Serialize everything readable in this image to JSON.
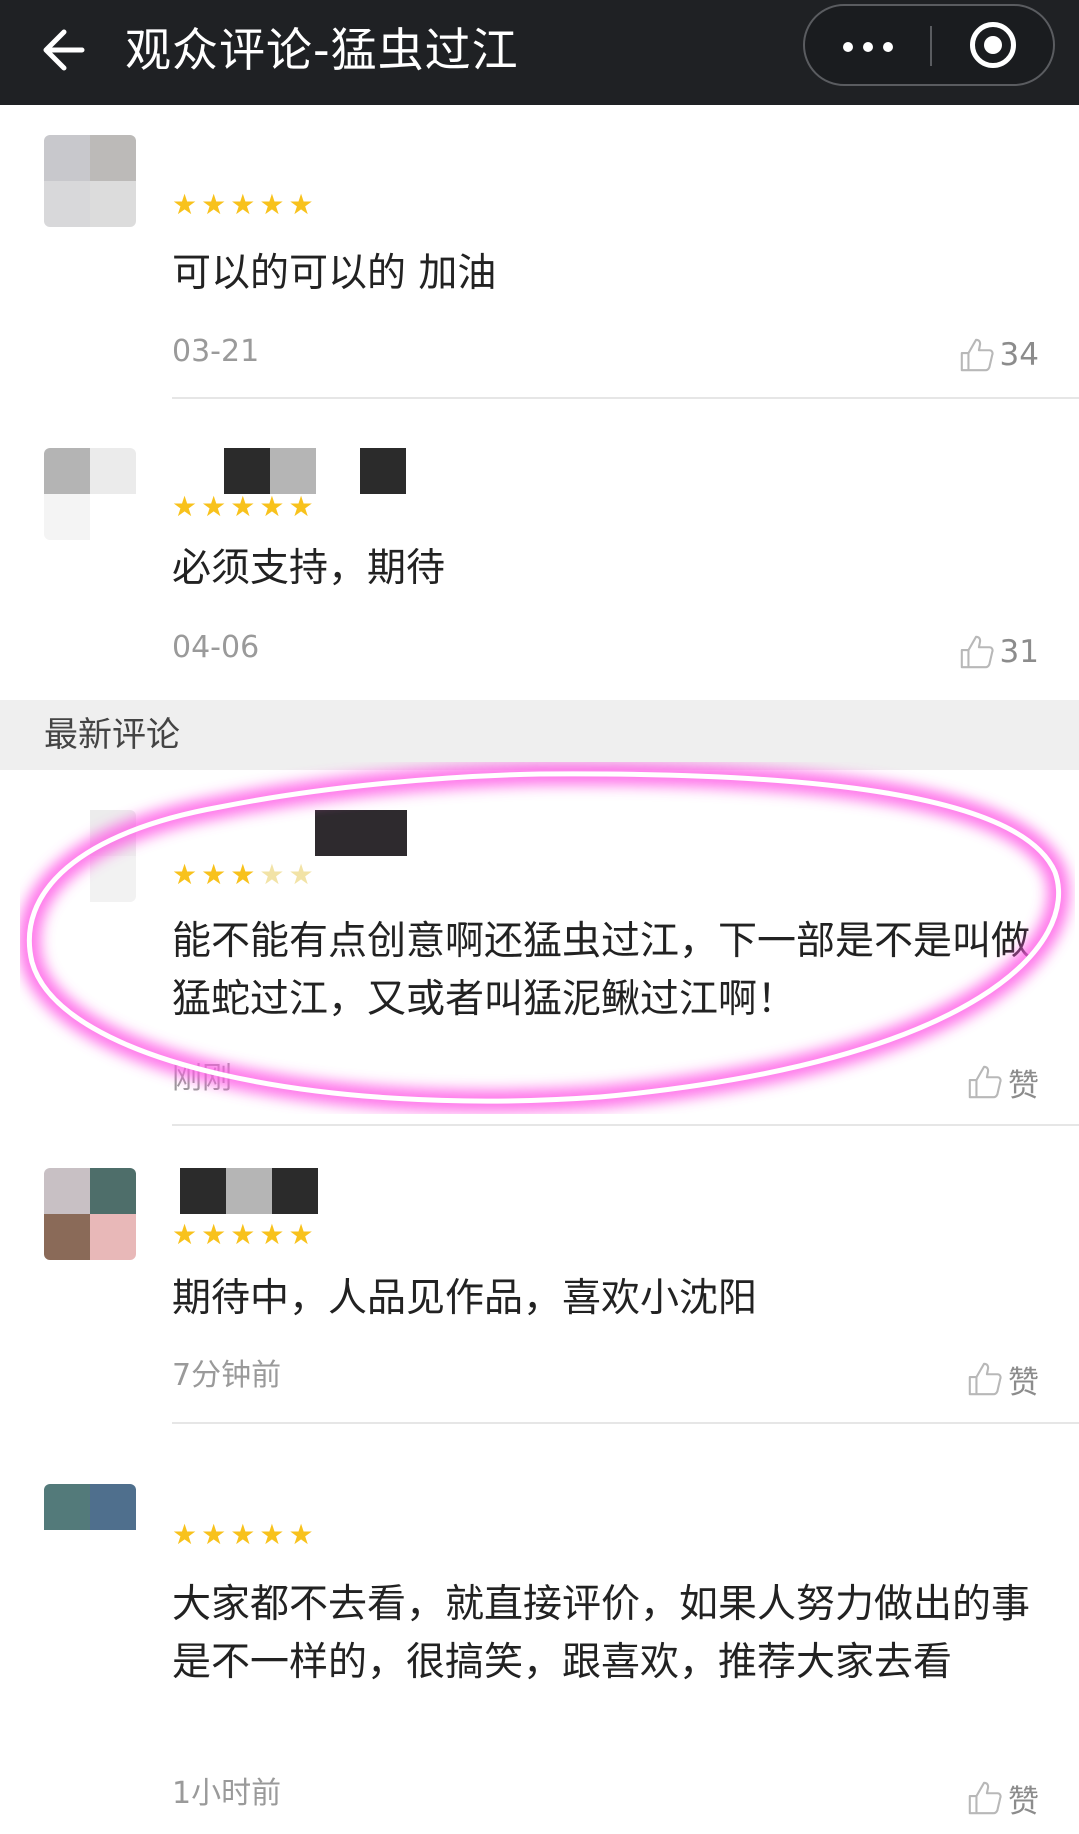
{
  "header": {
    "title": "观众评论-猛虫过江"
  },
  "section_label": "最新评论",
  "comments": [
    {
      "stars": 5,
      "text": "可以的可以的 加油",
      "time": "03-21",
      "like": "34"
    },
    {
      "stars": 5,
      "text": "必须支持，期待",
      "time": "04-06",
      "like": "31"
    },
    {
      "stars": 3,
      "text": "能不能有点创意啊还猛虫过江，下一部是不是叫做猛蛇过江，又或者叫猛泥鳅过江啊！",
      "time": "刚刚",
      "like": "赞"
    },
    {
      "stars": 5,
      "text": "期待中，人品见作品，喜欢小沈阳",
      "time": "7分钟前",
      "like": "赞"
    },
    {
      "stars": 5,
      "text": "大家都不去看，就直接评价，如果人努力做出的事是不一样的，很搞笑，跟喜欢，推荐大家去看",
      "time": "1小时前",
      "like": "赞"
    }
  ],
  "colors": {
    "topbar": "#1f2124",
    "star_on": "#f8c21c",
    "highlight_circle": "#ff5ce6"
  }
}
